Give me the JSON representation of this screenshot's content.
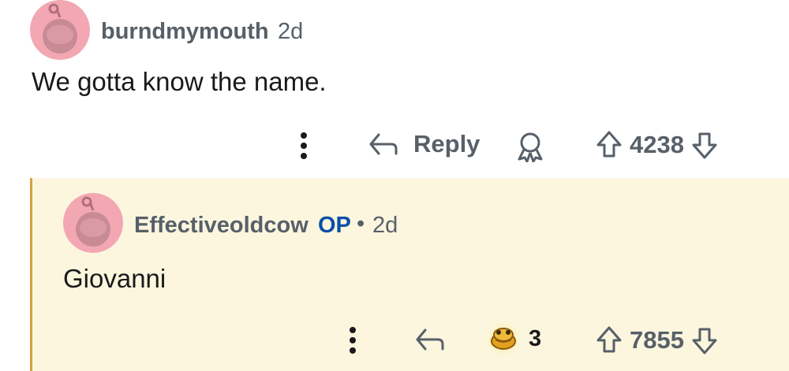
{
  "comment": {
    "username": "burndmymouth",
    "time": "2d",
    "text": "We gotta know the name.",
    "actions": {
      "more_icon": "vertical-dots-icon",
      "reply_label": "Reply",
      "award_icon": "award-icon",
      "score": "4238"
    }
  },
  "reply": {
    "username": "Effectiveoldcow",
    "op_label": "OP",
    "separator": "•",
    "time": "2d",
    "text": "Giovanni",
    "actions": {
      "more_icon": "vertical-dots-icon",
      "reply_icon": "reply-arrow-icon",
      "award_count": "3",
      "score": "7855"
    }
  },
  "colors": {
    "avatar_bg": "#f2a7b3",
    "reply_bg": "#fcf6df",
    "thread_line": "#d7a23f",
    "op_blue": "#0a4fa6",
    "meta_gray": "#576069"
  }
}
